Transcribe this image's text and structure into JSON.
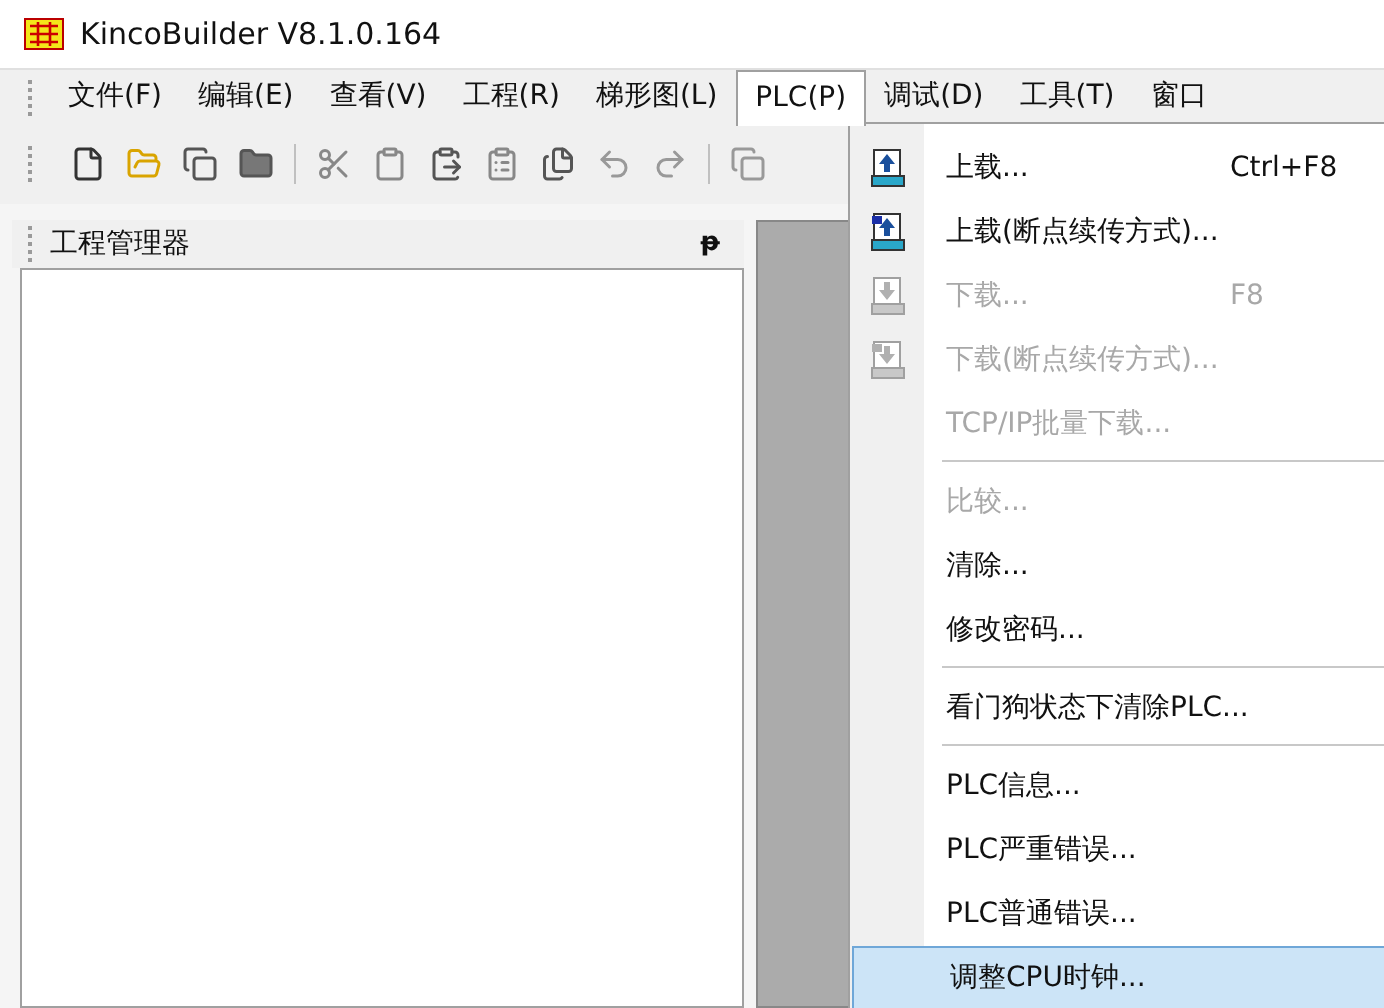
{
  "window": {
    "title": "KincoBuilder V8.1.0.164"
  },
  "menu_bar": [
    {
      "label": "文件(F)",
      "open": false
    },
    {
      "label": "编辑(E)",
      "open": false
    },
    {
      "label": "查看(V)",
      "open": false
    },
    {
      "label": "工程(R)",
      "open": false
    },
    {
      "label": "梯形图(L)",
      "open": false
    },
    {
      "label": "PLC(P)",
      "open": true
    },
    {
      "label": "调试(D)",
      "open": false
    },
    {
      "label": "工具(T)",
      "open": false
    },
    {
      "label": "窗口",
      "open": false
    }
  ],
  "panel": {
    "title": "工程管理器",
    "pin": "ᵽ"
  },
  "dropdown": [
    {
      "kind": "item",
      "label": "上载...",
      "shortcut": "Ctrl+F8",
      "disabled": false,
      "selected": false
    },
    {
      "kind": "item",
      "label": "上载(断点续传方式)...",
      "disabled": false,
      "selected": false
    },
    {
      "kind": "item",
      "label": "下载...",
      "shortcut": "F8",
      "disabled": true,
      "selected": false
    },
    {
      "kind": "item",
      "label": "下载(断点续传方式)...",
      "disabled": true,
      "selected": false
    },
    {
      "kind": "item",
      "label": "TCP/IP批量下载...",
      "disabled": true,
      "selected": false
    },
    {
      "kind": "separator"
    },
    {
      "kind": "item",
      "label": "比较...",
      "disabled": true,
      "selected": false
    },
    {
      "kind": "item",
      "label": "清除...",
      "disabled": false,
      "selected": false
    },
    {
      "kind": "item",
      "label": "修改密码...",
      "disabled": false,
      "selected": false
    },
    {
      "kind": "separator"
    },
    {
      "kind": "item",
      "label": "看门狗状态下清除PLC...",
      "disabled": false,
      "selected": false
    },
    {
      "kind": "separator"
    },
    {
      "kind": "item",
      "label": "PLC信息...",
      "disabled": false,
      "selected": false
    },
    {
      "kind": "item",
      "label": "PLC严重错误...",
      "disabled": false,
      "selected": false
    },
    {
      "kind": "item",
      "label": "PLC普通错误...",
      "disabled": false,
      "selected": false
    },
    {
      "kind": "item",
      "label": "调整CPU时钟...",
      "disabled": false,
      "selected": true
    }
  ]
}
